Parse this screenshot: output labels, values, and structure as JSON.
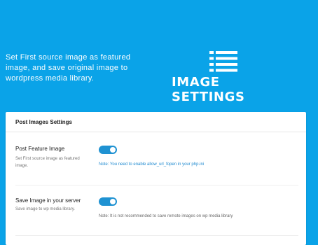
{
  "hero": {
    "description": "Set First source image as featured image, and save original image to wordpress media library.",
    "title": "IMAGE SETTINGS",
    "icon": "list-icon"
  },
  "panel": {
    "title": "Post Images Settings",
    "rows": [
      {
        "label": "Post Feature Image",
        "description": "Set First source image as featured image.",
        "toggle_on": true,
        "note": "Note: You need to enable allow_url_fopen in your php.ini"
      },
      {
        "label": "Save Image in your server",
        "description": "Save image to wp media library.",
        "toggle_on": true,
        "note": "Note: It is not recommended to save remote images on wp media library"
      }
    ]
  },
  "colors": {
    "background": "#0aa3e8",
    "toggle": "#1f92d2",
    "note_link": "#1f8ad0"
  }
}
